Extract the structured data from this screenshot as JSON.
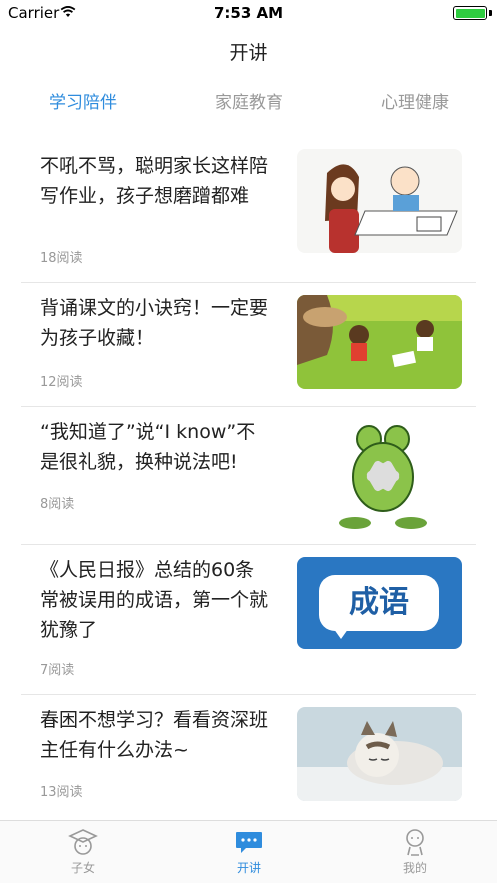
{
  "status_bar": {
    "carrier": "Carrier",
    "time": "7:53 AM"
  },
  "nav": {
    "title": "开讲"
  },
  "tabs": [
    {
      "label": "学习陪伴",
      "active": true
    },
    {
      "label": "家庭教育",
      "active": false
    },
    {
      "label": "心理健康",
      "active": false
    }
  ],
  "articles": [
    {
      "title": "不吼不骂，聪明家长这样陪写作业，孩子想磨蹭都难",
      "reads": "18阅读",
      "thumb_icon": "cartoon-homework-thumbnail"
    },
    {
      "title": "背诵课文的小诀窍！一定要为孩子收藏！",
      "reads": "12阅读",
      "thumb_icon": "children-reading-thumbnail"
    },
    {
      "title": "“我知道了”说“I know”不是很礼貌，换种说法吧!",
      "reads": "8阅读",
      "thumb_icon": "frog-thumbnail"
    },
    {
      "title": "《人民日报》总结的60条常被误用的成语，第一个就犹豫了",
      "reads": "7阅读",
      "thumb_icon": "idiom-thumbnail",
      "thumb_text": "成语"
    },
    {
      "title": "春困不想学习？看看资深班主任有什么办法~",
      "reads": "13阅读",
      "thumb_icon": "sleeping-cat-thumbnail"
    }
  ],
  "tab_bar": [
    {
      "label": "子女",
      "icon": "graduate-icon",
      "active": false
    },
    {
      "label": "开讲",
      "icon": "chat-bubble-icon",
      "active": true
    },
    {
      "label": "我的",
      "icon": "person-icon",
      "active": false
    }
  ],
  "colors": {
    "accent": "#2f8cdd",
    "muted": "#999999",
    "battery": "#2ecc40"
  }
}
